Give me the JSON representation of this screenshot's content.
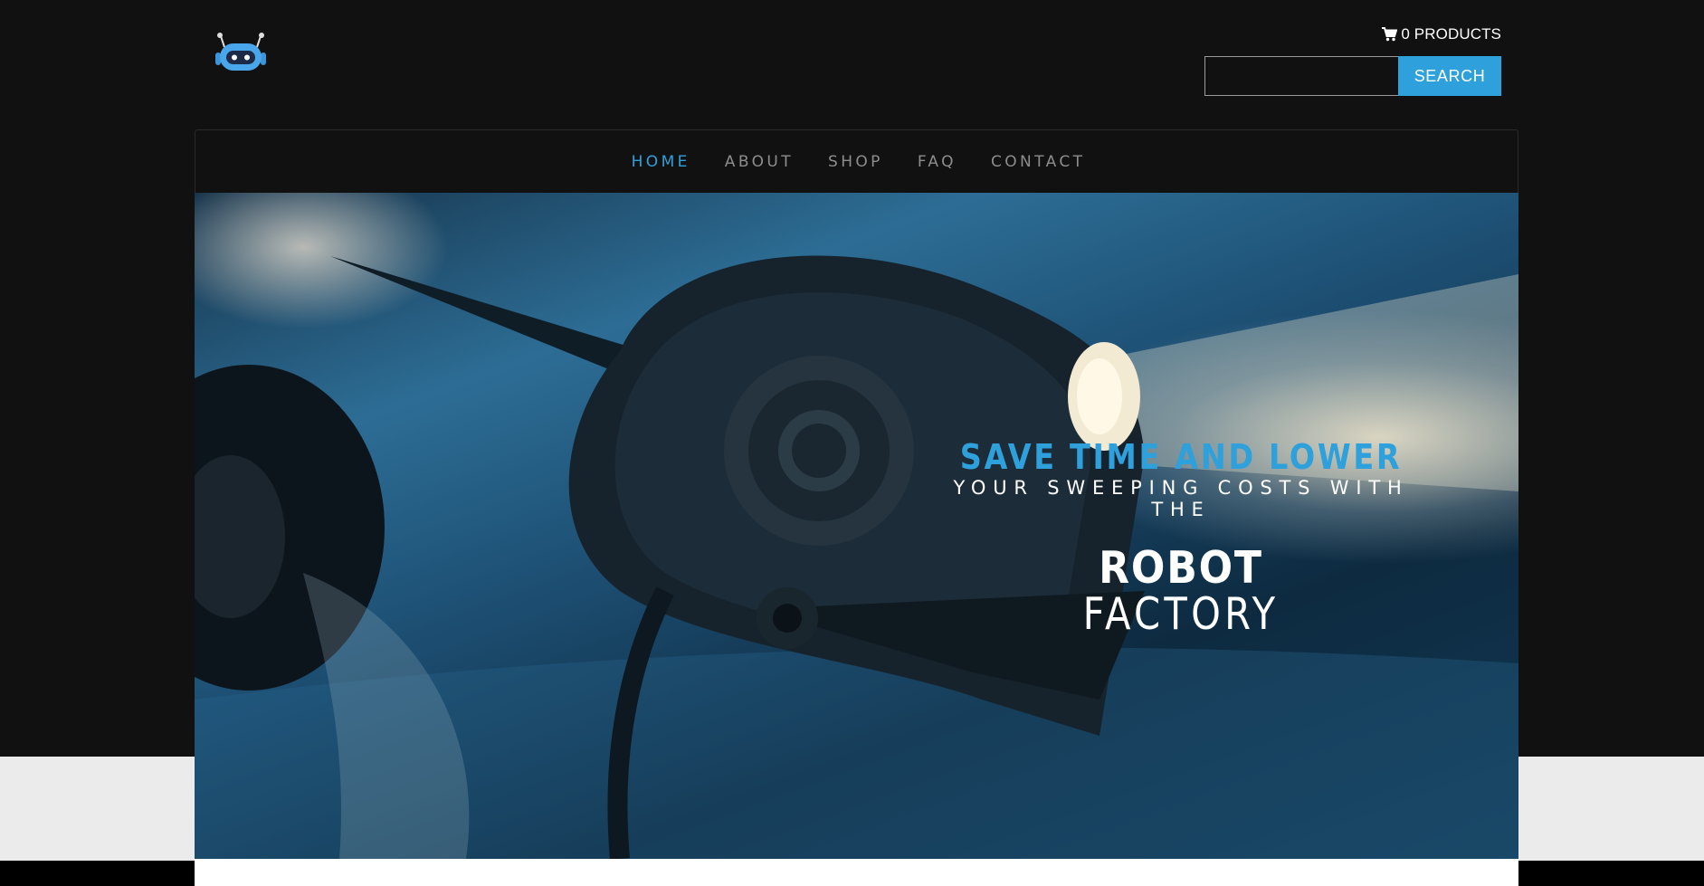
{
  "header": {
    "cart_label": "0 PRODUCTS",
    "search_placeholder": "",
    "search_button": "SEARCH"
  },
  "nav": {
    "items": [
      "HOME",
      "ABOUT",
      "SHOP",
      "FAQ",
      "CONTACT"
    ],
    "active": "HOME"
  },
  "hero": {
    "line1": "SAVE TIME AND LOWER",
    "line2": "YOUR SWEEPING COSTS WITH THE",
    "line3": "ROBOT",
    "line4": "FACTORY"
  },
  "icons": [
    "robot-logo-icon",
    "cart-icon"
  ],
  "colors": {
    "accent": "#2ea0dc",
    "background": "#111111",
    "nav_text": "#8d8d8d"
  }
}
